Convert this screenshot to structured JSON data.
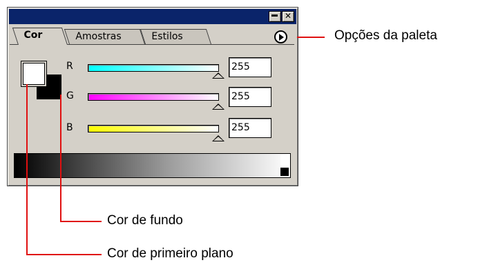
{
  "titlebar": {
    "close_glyph": "✕"
  },
  "tabs": [
    {
      "label": "Cor"
    },
    {
      "label": "Amostras"
    },
    {
      "label": "Estilos"
    }
  ],
  "channels": [
    {
      "label": "R",
      "value": "255",
      "slider_level": 1.0
    },
    {
      "label": "G",
      "value": "255",
      "slider_level": 1.0
    },
    {
      "label": "B",
      "value": "255",
      "slider_level": 1.0
    }
  ],
  "swatches": {
    "foreground": "#ffffff",
    "background": "#000000"
  },
  "callouts": {
    "options": "Opções da paleta",
    "background": "Cor de fundo",
    "foreground": "Cor de primeiro plano"
  },
  "colors": {
    "titlebar": "#0a246a",
    "panel": "#d4d0c8",
    "leader": "#e01010"
  },
  "icons": [
    "minimize-icon",
    "close-icon",
    "palette-menu-icon"
  ]
}
